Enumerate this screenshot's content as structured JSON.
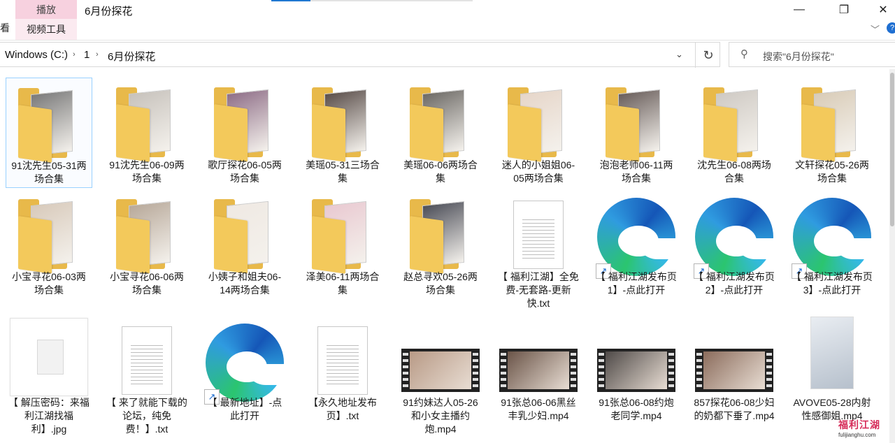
{
  "window": {
    "title": "6月份探花",
    "context_tab": "播放",
    "context_subtab": "视频工具",
    "ribbon_stub": "看",
    "minimize": "—",
    "maximize": "❐",
    "close": "✕",
    "help": "?",
    "ribbon_collapse": "﹀"
  },
  "address": {
    "crumbs": [
      "Windows (C:)",
      "1",
      "6月份探花"
    ],
    "separator": "›",
    "dropdown": "⌄",
    "refresh": "↻"
  },
  "search": {
    "icon": "search-icon",
    "placeholder": "搜索\"6月份探花\""
  },
  "colors": {
    "selection_border": "#99d1ff",
    "accent": "#1f78d1",
    "folder": "#f3c95b",
    "context_tab": "#f7d1df"
  },
  "items": [
    {
      "type": "folder",
      "label": "91沈先生05-31两场合集",
      "selected": true,
      "photo": "#7a7a7a"
    },
    {
      "type": "folder",
      "label": "91沈先生06-09两场合集",
      "photo": "#c7c2bc"
    },
    {
      "type": "folder",
      "label": "歌厅探花06-05两场合集",
      "photo": "#8f6f88"
    },
    {
      "type": "folder",
      "label": "美瑶05-31三场合集",
      "photo": "#5b4f4b"
    },
    {
      "type": "folder",
      "label": "美瑶06-06两场合集",
      "photo": "#6d6a66"
    },
    {
      "type": "folder",
      "label": "迷人的小姐姐06-05两场合集",
      "photo": "#e6d6c9"
    },
    {
      "type": "folder",
      "label": "泡泡老师06-11两场合集",
      "photo": "#6a5f5c"
    },
    {
      "type": "folder",
      "label": "沈先生06-08两场合集",
      "photo": "#cfcac4"
    },
    {
      "type": "folder",
      "label": "文轩探花05-26两场合集",
      "photo": "#d9ccb8"
    },
    {
      "type": "folder",
      "label": "小宝寻花06-03两场合集",
      "photo": "#d8cabb"
    },
    {
      "type": "folder",
      "label": "小宝寻花06-06两场合集",
      "photo": "#b8a99a"
    },
    {
      "type": "folder",
      "label": "小姨子和姐夫06-14两场合集",
      "photo": "#efe9e3"
    },
    {
      "type": "folder",
      "label": "泽美06-11两场合集",
      "photo": "#e9c9d1"
    },
    {
      "type": "folder",
      "label": "赵总寻欢05-26两场合集",
      "photo": "#4d4f59"
    },
    {
      "type": "doc",
      "label": "【 福利江湖】全免费-无套路-更新快.txt"
    },
    {
      "type": "edge",
      "label": "【 福利江湖发布页1】-点此打开"
    },
    {
      "type": "edge",
      "label": "【 福利江湖发布页2】-点此打开"
    },
    {
      "type": "edge",
      "label": "【 福利江湖发布页3】-点此打开"
    },
    {
      "type": "image",
      "label": "【 解压密码：来福利江湖找福利】.jpg"
    },
    {
      "type": "doc",
      "label": "【 来了就能下载的论坛，纯免费！】.txt"
    },
    {
      "type": "edge",
      "label": "【 最新地址】-点此打开"
    },
    {
      "type": "doc",
      "label": "【永久地址发布页】.txt"
    },
    {
      "type": "video",
      "label": "91约妹达人05-26和小女主播约炮.mp4",
      "photo": "#b89a86"
    },
    {
      "type": "video",
      "label": "91张总06-06黑丝丰乳少妇.mp4",
      "photo": "#6a5448"
    },
    {
      "type": "video",
      "label": "91张总06-08约炮老同学.mp4",
      "photo": "#4f4a48"
    },
    {
      "type": "video",
      "label": "857探花06-08少妇的奶都下垂了.mp4",
      "photo": "#8b6c5c"
    },
    {
      "type": "portrait",
      "label": "AVOVE05-28内射性感御姐.mp4",
      "photo": "#b6c0cc"
    }
  ],
  "watermark": {
    "brand": "福利江湖",
    "url": "fulijianghu.com"
  }
}
